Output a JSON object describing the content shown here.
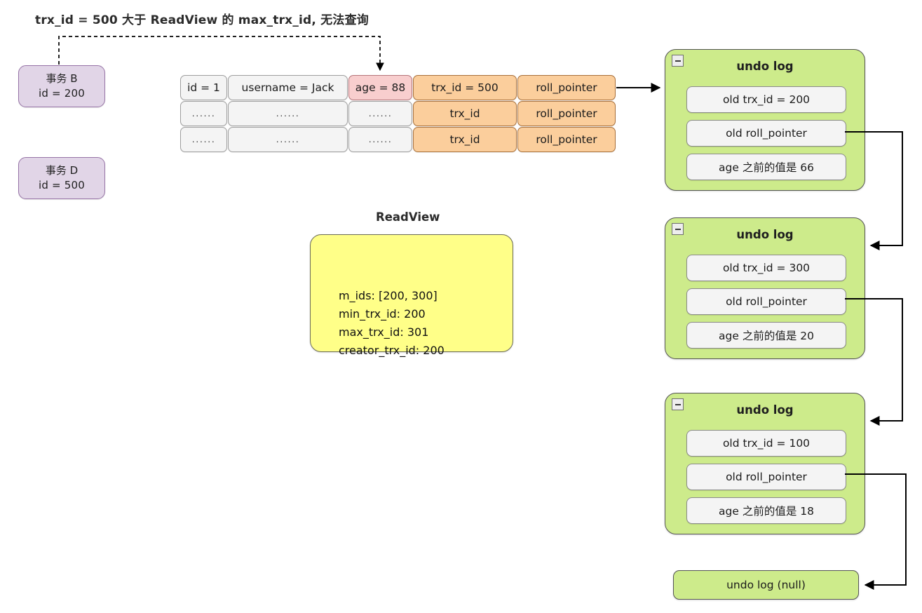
{
  "note": {
    "text": "trx_id = 500 大于 ReadView 的 max_trx_id, 无法查询"
  },
  "transactions": [
    {
      "name": "事务 B",
      "id_line": "id = 200"
    },
    {
      "name": "事务 D",
      "id_line": "id = 500"
    }
  ],
  "record_table": {
    "rows": [
      [
        "id = 1",
        "username = Jack",
        "age = 88",
        "trx_id = 500",
        "roll_pointer"
      ],
      [
        "......",
        "......",
        "......",
        "trx_id",
        "roll_pointer"
      ],
      [
        "......",
        "......",
        "......",
        "trx_id",
        "roll_pointer"
      ]
    ]
  },
  "readview": {
    "label": "ReadView",
    "lines": [
      "m_ids: [200, 300]",
      "min_trx_id: 200",
      "max_trx_id: 301",
      "creator_trx_id: 200"
    ]
  },
  "undo_logs": [
    {
      "title": "undo log",
      "rows": [
        "old trx_id = 200",
        "old roll_pointer",
        "age 之前的值是 66"
      ]
    },
    {
      "title": "undo log",
      "rows": [
        "old trx_id = 300",
        "old roll_pointer",
        "age 之前的值是 20"
      ]
    },
    {
      "title": "undo log",
      "rows": [
        "old trx_id = 100",
        "old roll_pointer",
        "age 之前的值是 18"
      ]
    }
  ],
  "undo_log_null": {
    "label": "undo log (null)"
  },
  "colors": {
    "transaction_fill": "#e1d5e7",
    "transaction_stroke": "#9673a6",
    "highlight_fill": "#f8cecc",
    "pointer_fill": "#ffcc99",
    "undo_fill": "#cdeb8b",
    "readview_fill": "#ffff88",
    "cell_fill": "#f4f4f4",
    "line": "#000000"
  }
}
